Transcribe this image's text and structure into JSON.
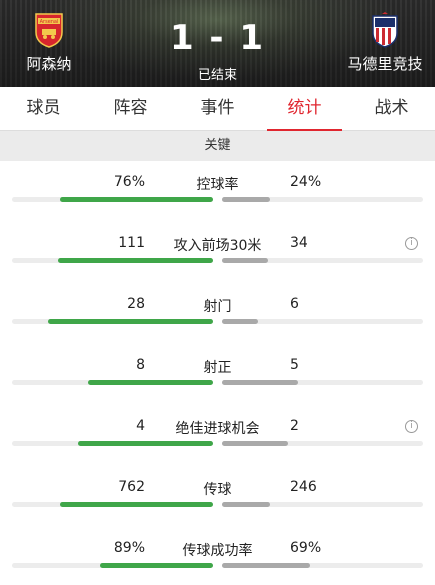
{
  "match": {
    "home_team": "阿森纳",
    "away_team": "马德里竞技",
    "score": "1 - 1",
    "status": "已结束",
    "home_badge_text": "Arsenal",
    "home_badge_icon": "arsenal-crest-icon",
    "away_badge_icon": "atletico-crest-icon"
  },
  "tabs": [
    {
      "label": "球员",
      "active": false
    },
    {
      "label": "阵容",
      "active": false
    },
    {
      "label": "事件",
      "active": false
    },
    {
      "label": "统计",
      "active": true
    },
    {
      "label": "战术",
      "active": false
    }
  ],
  "section_title": "关键",
  "colors": {
    "accent": "#e0262f",
    "home_bar": "#3fa649",
    "away_bar": "#a9a9a9"
  },
  "stats": [
    {
      "label": "控球率",
      "home": "76%",
      "away": "24%",
      "home_share": 0.76,
      "away_share": 0.24,
      "info": false
    },
    {
      "label": "攻入前场30米",
      "home": "111",
      "away": "34",
      "home_share": 0.77,
      "away_share": 0.23,
      "info": true
    },
    {
      "label": "射门",
      "home": "28",
      "away": "6",
      "home_share": 0.82,
      "away_share": 0.18,
      "info": false
    },
    {
      "label": "射正",
      "home": "8",
      "away": "5",
      "home_share": 0.62,
      "away_share": 0.38,
      "info": false
    },
    {
      "label": "绝佳进球机会",
      "home": "4",
      "away": "2",
      "home_share": 0.67,
      "away_share": 0.33,
      "info": true
    },
    {
      "label": "传球",
      "home": "762",
      "away": "246",
      "home_share": 0.76,
      "away_share": 0.24,
      "info": false
    },
    {
      "label": "传球成功率",
      "home": "89%",
      "away": "69%",
      "home_share": 0.56,
      "away_share": 0.44,
      "info": false
    }
  ]
}
